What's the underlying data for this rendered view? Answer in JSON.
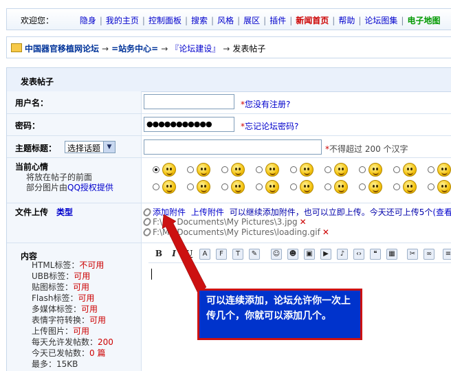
{
  "topbar": {
    "welcome": "欢迎您：",
    "items": [
      {
        "label": "隐身",
        "style": "normal"
      },
      {
        "label": "我的主页",
        "style": "normal"
      },
      {
        "label": "控制面板",
        "style": "normal"
      },
      {
        "label": "搜索",
        "style": "normal"
      },
      {
        "label": "风格",
        "style": "normal"
      },
      {
        "label": "展区",
        "style": "normal"
      },
      {
        "label": "插件",
        "style": "normal"
      },
      {
        "label": "新闻首页",
        "style": "red"
      },
      {
        "label": "帮助",
        "style": "normal"
      },
      {
        "label": "论坛图集",
        "style": "normal"
      },
      {
        "label": "电子地图",
        "style": "green"
      }
    ]
  },
  "breadcrumb": {
    "site": "中国器官移植网论坛",
    "center": "=站务中心=",
    "board": "『论坛建设』",
    "current": "发表帖子"
  },
  "form": {
    "title": "发表帖子",
    "username": {
      "label": "用户名：",
      "value": "",
      "hint": "您没有注册?"
    },
    "password": {
      "label": "密码：",
      "value": "●●●●●●●●●●●",
      "hint": "忘记论坛密码?"
    },
    "subject": {
      "label": "主题标题：",
      "select": "选择话题",
      "value": "",
      "hint": "不得超过 200 个汉字"
    },
    "mood": {
      "label": "当前心情",
      "desc1": "将放在帖子的前面",
      "desc2_pre": "部分图片由",
      "desc2_link": "QQ授权提供",
      "selected_index": 0,
      "count": 18
    },
    "upload": {
      "label": "文件上传",
      "type_link": "类型",
      "add": "添加附件",
      "upload": "上传附件",
      "note": "可以继续添加附件，也可以立即上传。今天还可上传5个",
      "view": "(查看",
      "files": [
        "F:\\My Documents\\My Pictures\\3.jpg",
        "F:\\My Documents\\My Pictures\\loading.gif"
      ]
    },
    "content": {
      "label": "内容",
      "info": [
        {
          "k": "HTML标签：",
          "v": "不可用"
        },
        {
          "k": "UBB标签：",
          "v": "可用"
        },
        {
          "k": "贴图标签：",
          "v": "可用"
        },
        {
          "k": "Flash标签：",
          "v": "可用"
        },
        {
          "k": "多媒体标签：",
          "v": "可用"
        },
        {
          "k": "表情字符转换：",
          "v": "可用"
        },
        {
          "k": "上传图片：",
          "v": "可用"
        },
        {
          "k": "每天允许发帖数：",
          "v": "200"
        },
        {
          "k": "今天已发帖数：",
          "v": "0 篇"
        },
        {
          "k": "最多：",
          "v": "15KB"
        }
      ]
    }
  },
  "toolbar": {
    "bold": "B",
    "italic": "I",
    "underline": "U",
    "icons": [
      "font-size-icon",
      "font-face-icon",
      "text-color-icon",
      "highlight-icon",
      "emoticon-icon",
      "smiley-icon",
      "image-icon",
      "flash-icon",
      "music-icon",
      "code-icon",
      "quote-icon",
      "table-icon",
      "clean-icon",
      "link-icon",
      "align-left-icon",
      "align-center-icon"
    ]
  },
  "callout": {
    "text": "可以连续添加，论坛允许你一次上传几个，你就可以添加几个。"
  },
  "colors": {
    "link": "#0000cc",
    "red": "#cc0000",
    "green": "#009900",
    "callout_bg": "#0033cc",
    "callout_border": "#cc1111"
  }
}
